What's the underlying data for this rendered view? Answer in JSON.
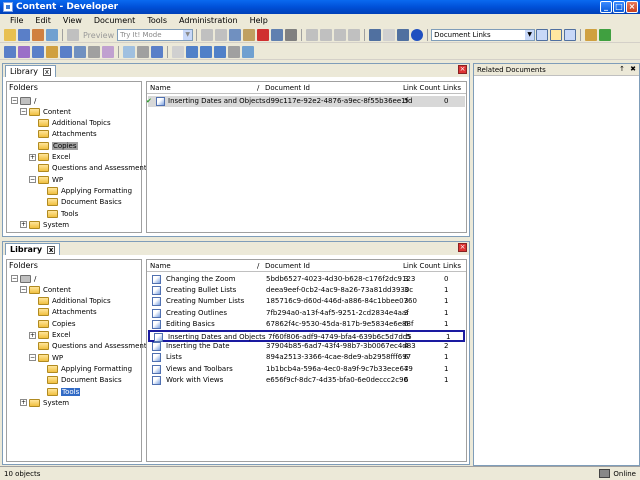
{
  "window": {
    "title": "Content - Developer"
  },
  "menu": [
    "File",
    "Edit",
    "View",
    "Document",
    "Tools",
    "Administration",
    "Help"
  ],
  "toolbar": {
    "preview_label": "Preview",
    "mode_value": "Try It! Mode",
    "document_links_value": "Document Links"
  },
  "colors": {
    "titlebar": "#0050d8",
    "selection": "#316ac5",
    "highlight_box": "#1a1aa0",
    "accent": "#0a6af0"
  },
  "top_library": {
    "tab_label": "Library",
    "folders_header": "Folders",
    "tree": [
      {
        "label": "/",
        "level": 0,
        "expanded": true
      },
      {
        "label": "Content",
        "level": 1,
        "expanded": true
      },
      {
        "label": "Additional Topics",
        "level": 2
      },
      {
        "label": "Attachments",
        "level": 2
      },
      {
        "label": "Copies",
        "level": 2,
        "highlighted": true
      },
      {
        "label": "Excel",
        "level": 2,
        "expandable": true
      },
      {
        "label": "Questions and Assessments",
        "level": 2
      },
      {
        "label": "WP",
        "level": 2,
        "expanded": true
      },
      {
        "label": "Applying Formatting",
        "level": 3
      },
      {
        "label": "Document Basics",
        "level": 3
      },
      {
        "label": "Tools",
        "level": 3
      },
      {
        "label": "System",
        "level": 1,
        "expandable": true
      }
    ],
    "columns": {
      "name": "Name",
      "sort": "/",
      "doc_id": "Document Id",
      "link_count": "Link Count",
      "links": "Links"
    },
    "rows": [
      {
        "name": "Inserting Dates and Objects",
        "doc_id": "d99c117e-92e2-4876-a9ec-8f55b36ee1fd",
        "link_count": "5",
        "links": "0",
        "check": "✔"
      }
    ]
  },
  "bottom_library": {
    "tab_label": "Library",
    "folders_header": "Folders",
    "tree": [
      {
        "label": "/",
        "level": 0,
        "expanded": true
      },
      {
        "label": "Content",
        "level": 1,
        "expanded": true
      },
      {
        "label": "Additional Topics",
        "level": 2
      },
      {
        "label": "Attachments",
        "level": 2
      },
      {
        "label": "Copies",
        "level": 2
      },
      {
        "label": "Excel",
        "level": 2,
        "expandable": true
      },
      {
        "label": "Questions and Assessments",
        "level": 2
      },
      {
        "label": "WP",
        "level": 2,
        "expanded": true
      },
      {
        "label": "Applying Formatting",
        "level": 3
      },
      {
        "label": "Document Basics",
        "level": 3
      },
      {
        "label": "Tools",
        "level": 3,
        "selected": true
      },
      {
        "label": "System",
        "level": 1,
        "expandable": true
      }
    ],
    "columns": {
      "name": "Name",
      "sort": "/",
      "doc_id": "Document Id",
      "link_count": "Link Count",
      "links": "Links"
    },
    "rows": [
      {
        "name": "Changing the Zoom",
        "doc_id": "5bdb6527-4023-4d30-b628-c176f2dc9123",
        "link_count": "3",
        "links": "0"
      },
      {
        "name": "Creating Bullet Lists",
        "doc_id": "deea9eef-0cb2-4ac9-8a26-73a81dd3930c",
        "link_count": "3",
        "links": "1"
      },
      {
        "name": "Creating Number Lists",
        "doc_id": "185716c9-d60d-446d-a886-84c1bbee0760",
        "link_count": "3",
        "links": "1"
      },
      {
        "name": "Creating Outlines",
        "doc_id": "7fb294a0-a13f-4af5-9251-2cd2834e4aaf",
        "link_count": "3",
        "links": "1"
      },
      {
        "name": "Editing Basics",
        "doc_id": "67862f4c-9530-45da-817b-9e5834e6e88f",
        "link_count": "6",
        "links": "1"
      },
      {
        "name": "Inserting Dates and Objects",
        "doc_id": "7f60f806-adf9-4749-bfa4-639b6c5d7dd5",
        "link_count": "5",
        "links": "1",
        "boxed": true
      },
      {
        "name": "Inserting the Date",
        "doc_id": "37904b85-6ad7-43f4-98b7-3b0067ec4d83",
        "link_count": "4",
        "links": "2"
      },
      {
        "name": "Lists",
        "doc_id": "894a2513-3366-4cae-8de9-ab2958fff697",
        "link_count": "6",
        "links": "1"
      },
      {
        "name": "Views and Toolbars",
        "doc_id": "1b1bcb4a-596a-4ec0-8a9f-9c7b33ece679",
        "link_count": "4",
        "links": "1"
      },
      {
        "name": "Work with Views",
        "doc_id": "e656f9cf-8dc7-4d35-bfa0-6e0deccc2c90",
        "link_count": "6",
        "links": "1"
      }
    ]
  },
  "related": {
    "title": "Related Documents",
    "pin": "↑",
    "close": "✖"
  },
  "status": {
    "left": "10 objects",
    "right": "Online"
  }
}
